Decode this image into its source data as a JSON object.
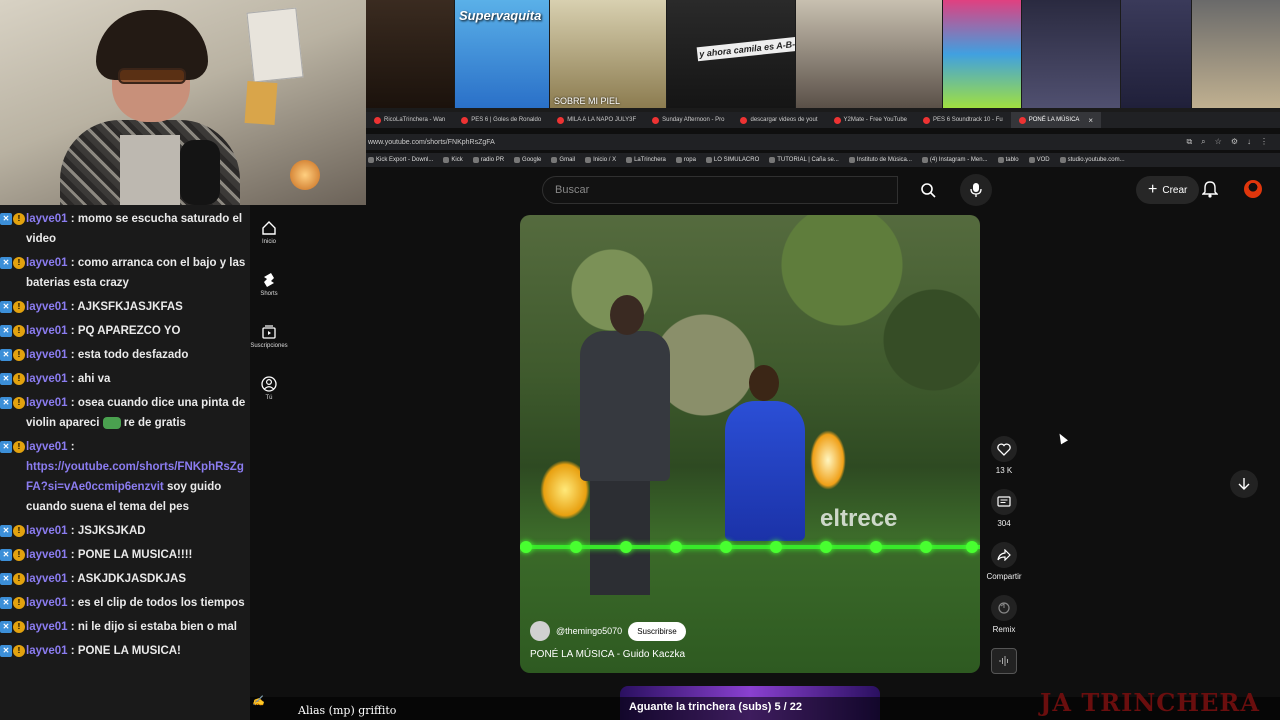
{
  "stream": {
    "tab_thumbs": [
      {
        "label": "",
        "big": ""
      },
      {
        "label": "",
        "big": "Supervaquita"
      },
      {
        "label": "SOBRE MI PIEL",
        "big": ""
      },
      {
        "label": "",
        "big": "y ahora camila es A-B-O-GA-DA"
      },
      {
        "label": "",
        "big": ""
      },
      {
        "label": "",
        "big": ""
      },
      {
        "label": "",
        "big": ""
      },
      {
        "label": "",
        "big": ""
      },
      {
        "label": "",
        "big": ""
      }
    ],
    "browser": {
      "tabs": [
        "RicoLaTrinchera - Wan",
        "PES 6 | Goles de Ronaldo",
        "MILA A LA NAPO JULY3F",
        "Sunday Afternoon - Pro",
        "descargar videos de yout",
        "Y2Mate - Free YouTube",
        "PES 6 Soundtrack 10 - Fu",
        "PONÉ LA MÚSICA"
      ],
      "active_tab": "PONÉ LA MÚSICA",
      "url": "www.youtube.com/shorts/FNKphRsZgFA",
      "bookmarks": [
        "Kick Export - Downl...",
        "Kick",
        "radio PR",
        "Google",
        "Gmail",
        "Inicio / X",
        "LaTrinchera",
        "ropa",
        "LO SIMULACRO",
        "TUTORIAL | Caña se...",
        "Instituto de Música...",
        "(4) Instagram - Men...",
        "tablo",
        "VOD",
        "studio.youtube.com..."
      ]
    },
    "chat": [
      {
        "user": "layve01",
        "text": "momo se escucha saturado el video"
      },
      {
        "user": "layve01",
        "text": "como arranca con el bajo y las baterias esta crazy"
      },
      {
        "user": "layve01",
        "text": "AJKSFKJASJKFAS"
      },
      {
        "user": "layve01",
        "text": "PQ APAREZCO YO"
      },
      {
        "user": "layve01",
        "text": "esta todo desfazado"
      },
      {
        "user": "layve01",
        "text": "ahi va"
      },
      {
        "user": "layve01",
        "text": "osea cuando dice una pinta de violin apareci",
        "emote": true,
        "text_after": "re de gratis"
      },
      {
        "user": "layve01",
        "text": "",
        "link": "https://youtube.com/shorts/FNKphRsZgFA?si=vAe0ccmip6enzvit",
        "text_after": "soy guido cuando suena el tema del pes"
      },
      {
        "user": "layve01",
        "text": "JSJKSJKAD"
      },
      {
        "user": "layve01",
        "text": "PONE LA MUSICA!!!!"
      },
      {
        "user": "layve01",
        "text": "ASKJDKJASDKJAS"
      },
      {
        "user": "layve01",
        "text": "es el clip de todos los tiempos"
      },
      {
        "user": "layve01",
        "text": "ni le dijo si estaba bien o mal"
      },
      {
        "user": "layve01",
        "text": "PONE LA MUSICA!"
      }
    ],
    "overlay": {
      "alias": "Alias (mp) griffito",
      "goal": "Aguante la trinchera (subs) 5 / 22",
      "logo": "JA TRINCHERA"
    }
  },
  "youtube": {
    "search_placeholder": "Buscar",
    "create_label": "Crear",
    "nav": [
      {
        "label": "Inicio",
        "icon": "home-icon"
      },
      {
        "label": "Shorts",
        "icon": "shorts-icon"
      },
      {
        "label": "Suscripciones",
        "icon": "subscriptions-icon"
      },
      {
        "label": "Tú",
        "icon": "you-icon"
      }
    ],
    "video": {
      "channel": "@themingo5070",
      "subscribe_label": "Suscribirse",
      "title": "PONÉ LA MÚSICA - Guido Kaczka",
      "watermark": "eltrece"
    },
    "actions": {
      "likes": "13 K",
      "comments": "304",
      "share": "Compartir",
      "remix": "Remix"
    },
    "colors": {
      "accent": "#38e82a",
      "subscribe_bg": "#ffffff",
      "brand": "#e0360c"
    }
  }
}
